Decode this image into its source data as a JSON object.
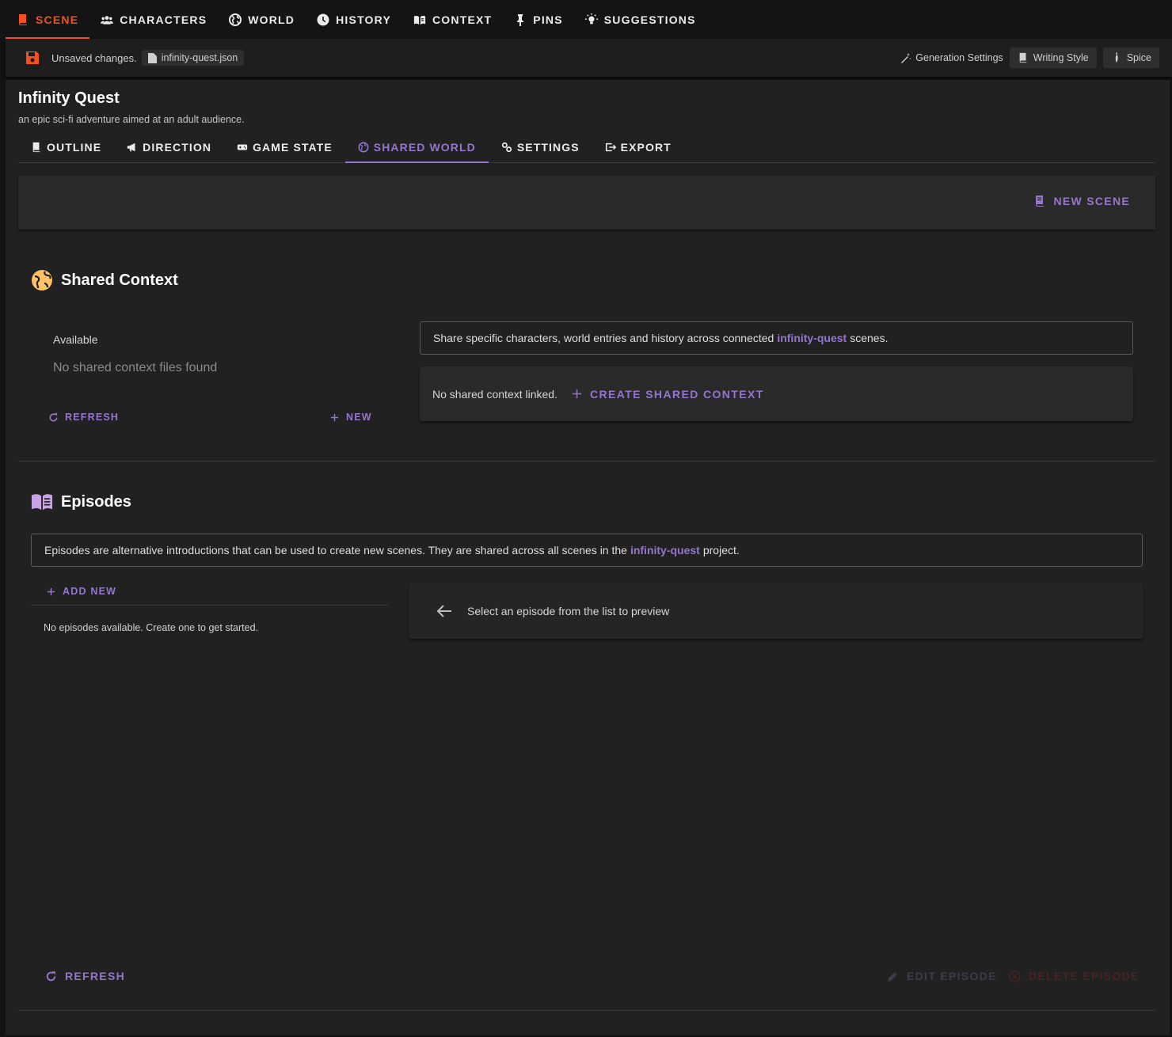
{
  "topnav": {
    "tabs": [
      {
        "label": "Scene",
        "icon": "book-icon"
      },
      {
        "label": "Characters",
        "icon": "people-icon"
      },
      {
        "label": "World",
        "icon": "globe-icon"
      },
      {
        "label": "History",
        "icon": "clock-icon"
      },
      {
        "label": "Context",
        "icon": "book-open-icon"
      },
      {
        "label": "Pins",
        "icon": "pin-icon"
      },
      {
        "label": "Suggestions",
        "icon": "lightbulb-icon"
      }
    ],
    "active_index": 0,
    "active_color": "#f4511e"
  },
  "statusbar": {
    "unsaved_text": "Unsaved changes.",
    "file_name": "infinity-quest.json",
    "generation_settings": "Generation Settings",
    "writing_style": "Writing Style",
    "spice": "Spice"
  },
  "scene": {
    "title": "Infinity Quest",
    "description": "an epic sci-fi adventure aimed at an adult audience."
  },
  "subtabs": {
    "items": [
      "Outline",
      "Direction",
      "Game State",
      "Shared World",
      "Settings",
      "Export"
    ],
    "active_index": 3,
    "accent_color": "#9575cd"
  },
  "toolbar": {
    "new_scene": "New Scene"
  },
  "shared_context": {
    "heading": "Shared Context",
    "available_label": "Available",
    "empty_text": "No shared context files found",
    "refresh": "Refresh",
    "new": "New",
    "info_prefix": "Share specific characters, world entries and history across connected",
    "info_project": "infinity-quest",
    "info_suffix": "scenes.",
    "linked_text": "No shared context linked.",
    "create_button": "Create Shared Context"
  },
  "episodes": {
    "heading": "Episodes",
    "info_prefix": "Episodes are alternative introductions that can be used to create new scenes. They are shared across all scenes in the",
    "info_project": "infinity-quest",
    "info_suffix": "project.",
    "add_new": "Add New",
    "empty_text": "No episodes available. Create one to get started.",
    "preview_text": "Select an episode from the list to preview",
    "refresh": "Refresh",
    "edit": "Edit Episode",
    "delete": "Delete Episode"
  }
}
